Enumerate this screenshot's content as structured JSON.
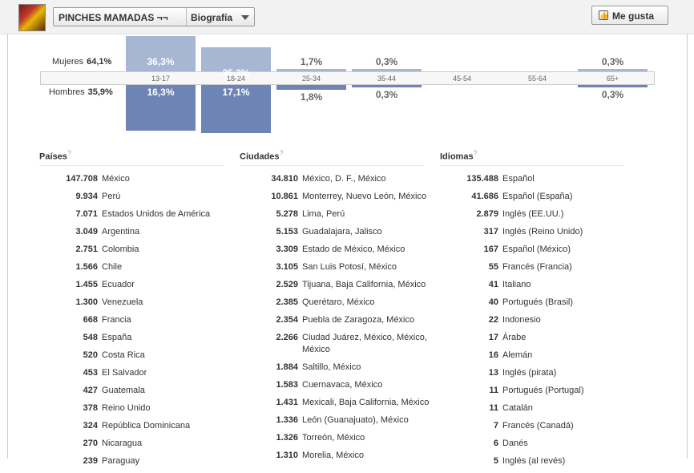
{
  "header": {
    "page_name": "PINCHES MAMADAS ¬¬",
    "section": "Biografía",
    "like_label": "Me gusta"
  },
  "demographics": {
    "women_label": "Mujeres",
    "women_total": "64,1%",
    "men_label": "Hombres",
    "men_total": "35,9%",
    "age_groups": [
      {
        "label": "13-17",
        "women": "36,3%",
        "men": "16,3%",
        "women_value": 36.3,
        "men_value": 16.3
      },
      {
        "label": "18-24",
        "women": "25,3%",
        "men": "17,1%",
        "women_value": 25.3,
        "men_value": 17.1
      },
      {
        "label": "25-34",
        "women": "1,7%",
        "men": "1,8%",
        "women_value": 1.7,
        "men_value": 1.8
      },
      {
        "label": "35-44",
        "women": "0,3%",
        "men": "0,3%",
        "women_value": 0.3,
        "men_value": 0.3
      },
      {
        "label": "45-54",
        "women": "",
        "men": "",
        "women_value": 0,
        "men_value": 0
      },
      {
        "label": "55-64",
        "women": "",
        "men": "",
        "women_value": 0,
        "men_value": 0
      },
      {
        "label": "65+",
        "women": "0,3%",
        "men": "0,3%",
        "women_value": 0.3,
        "men_value": 0.3
      }
    ]
  },
  "lists": [
    {
      "title": "Países",
      "help": "?",
      "items": [
        {
          "n": "147.708",
          "t": "México"
        },
        {
          "n": "9.934",
          "t": "Perú"
        },
        {
          "n": "7.071",
          "t": "Estados Unidos de América"
        },
        {
          "n": "3.049",
          "t": "Argentina"
        },
        {
          "n": "2.751",
          "t": "Colombia"
        },
        {
          "n": "1.566",
          "t": "Chile"
        },
        {
          "n": "1.455",
          "t": "Ecuador"
        },
        {
          "n": "1.300",
          "t": "Venezuela"
        },
        {
          "n": "668",
          "t": "Francia"
        },
        {
          "n": "548",
          "t": "España"
        },
        {
          "n": "520",
          "t": "Costa Rica"
        },
        {
          "n": "453",
          "t": "El Salvador"
        },
        {
          "n": "427",
          "t": "Guatemala"
        },
        {
          "n": "378",
          "t": "Reino Unido"
        },
        {
          "n": "324",
          "t": "República Dominicana"
        },
        {
          "n": "270",
          "t": "Nicaragua"
        },
        {
          "n": "239",
          "t": "Paraguay"
        }
      ]
    },
    {
      "title": "Ciudades",
      "help": "?",
      "items": [
        {
          "n": "34.810",
          "t": "México, D. F., México"
        },
        {
          "n": "10.861",
          "t": "Monterrey, Nuevo León, México"
        },
        {
          "n": "5.278",
          "t": "Lima, Perú"
        },
        {
          "n": "5.153",
          "t": "Guadalajara, Jalisco"
        },
        {
          "n": "3.309",
          "t": "Estado de México, México"
        },
        {
          "n": "3.105",
          "t": "San Luis Potosí, México"
        },
        {
          "n": "2.529",
          "t": "Tijuana, Baja California, México"
        },
        {
          "n": "2.385",
          "t": "Querétaro, México"
        },
        {
          "n": "2.354",
          "t": "Puebla de Zaragoza, México"
        },
        {
          "n": "2.266",
          "t": "Ciudad Juárez, México, México, México"
        },
        {
          "n": "1.884",
          "t": "Saltillo, México"
        },
        {
          "n": "1.583",
          "t": "Cuernavaca, México"
        },
        {
          "n": "1.431",
          "t": "Mexicali, Baja California, México"
        },
        {
          "n": "1.336",
          "t": "León (Guanajuato), México"
        },
        {
          "n": "1.326",
          "t": "Torreón, México"
        },
        {
          "n": "1.310",
          "t": "Morelia, México"
        }
      ]
    },
    {
      "title": "Idiomas",
      "help": "?",
      "items": [
        {
          "n": "135.488",
          "t": "Español"
        },
        {
          "n": "41.686",
          "t": "Español (España)"
        },
        {
          "n": "2.879",
          "t": "Inglés (EE.UU.)"
        },
        {
          "n": "317",
          "t": "Inglés (Reino Unido)"
        },
        {
          "n": "167",
          "t": "Español (México)"
        },
        {
          "n": "55",
          "t": "Francés (Francia)"
        },
        {
          "n": "41",
          "t": "Italiano"
        },
        {
          "n": "40",
          "t": "Portugués (Brasil)"
        },
        {
          "n": "22",
          "t": "Indonesio"
        },
        {
          "n": "17",
          "t": "Árabe"
        },
        {
          "n": "16",
          "t": "Alemán"
        },
        {
          "n": "13",
          "t": "Inglés (pirata)"
        },
        {
          "n": "11",
          "t": "Portugués (Portugal)"
        },
        {
          "n": "11",
          "t": "Catalán"
        },
        {
          "n": "7",
          "t": "Francés (Canadá)"
        },
        {
          "n": "6",
          "t": "Danés"
        },
        {
          "n": "5",
          "t": "Inglés (al revés)"
        }
      ]
    }
  ]
}
